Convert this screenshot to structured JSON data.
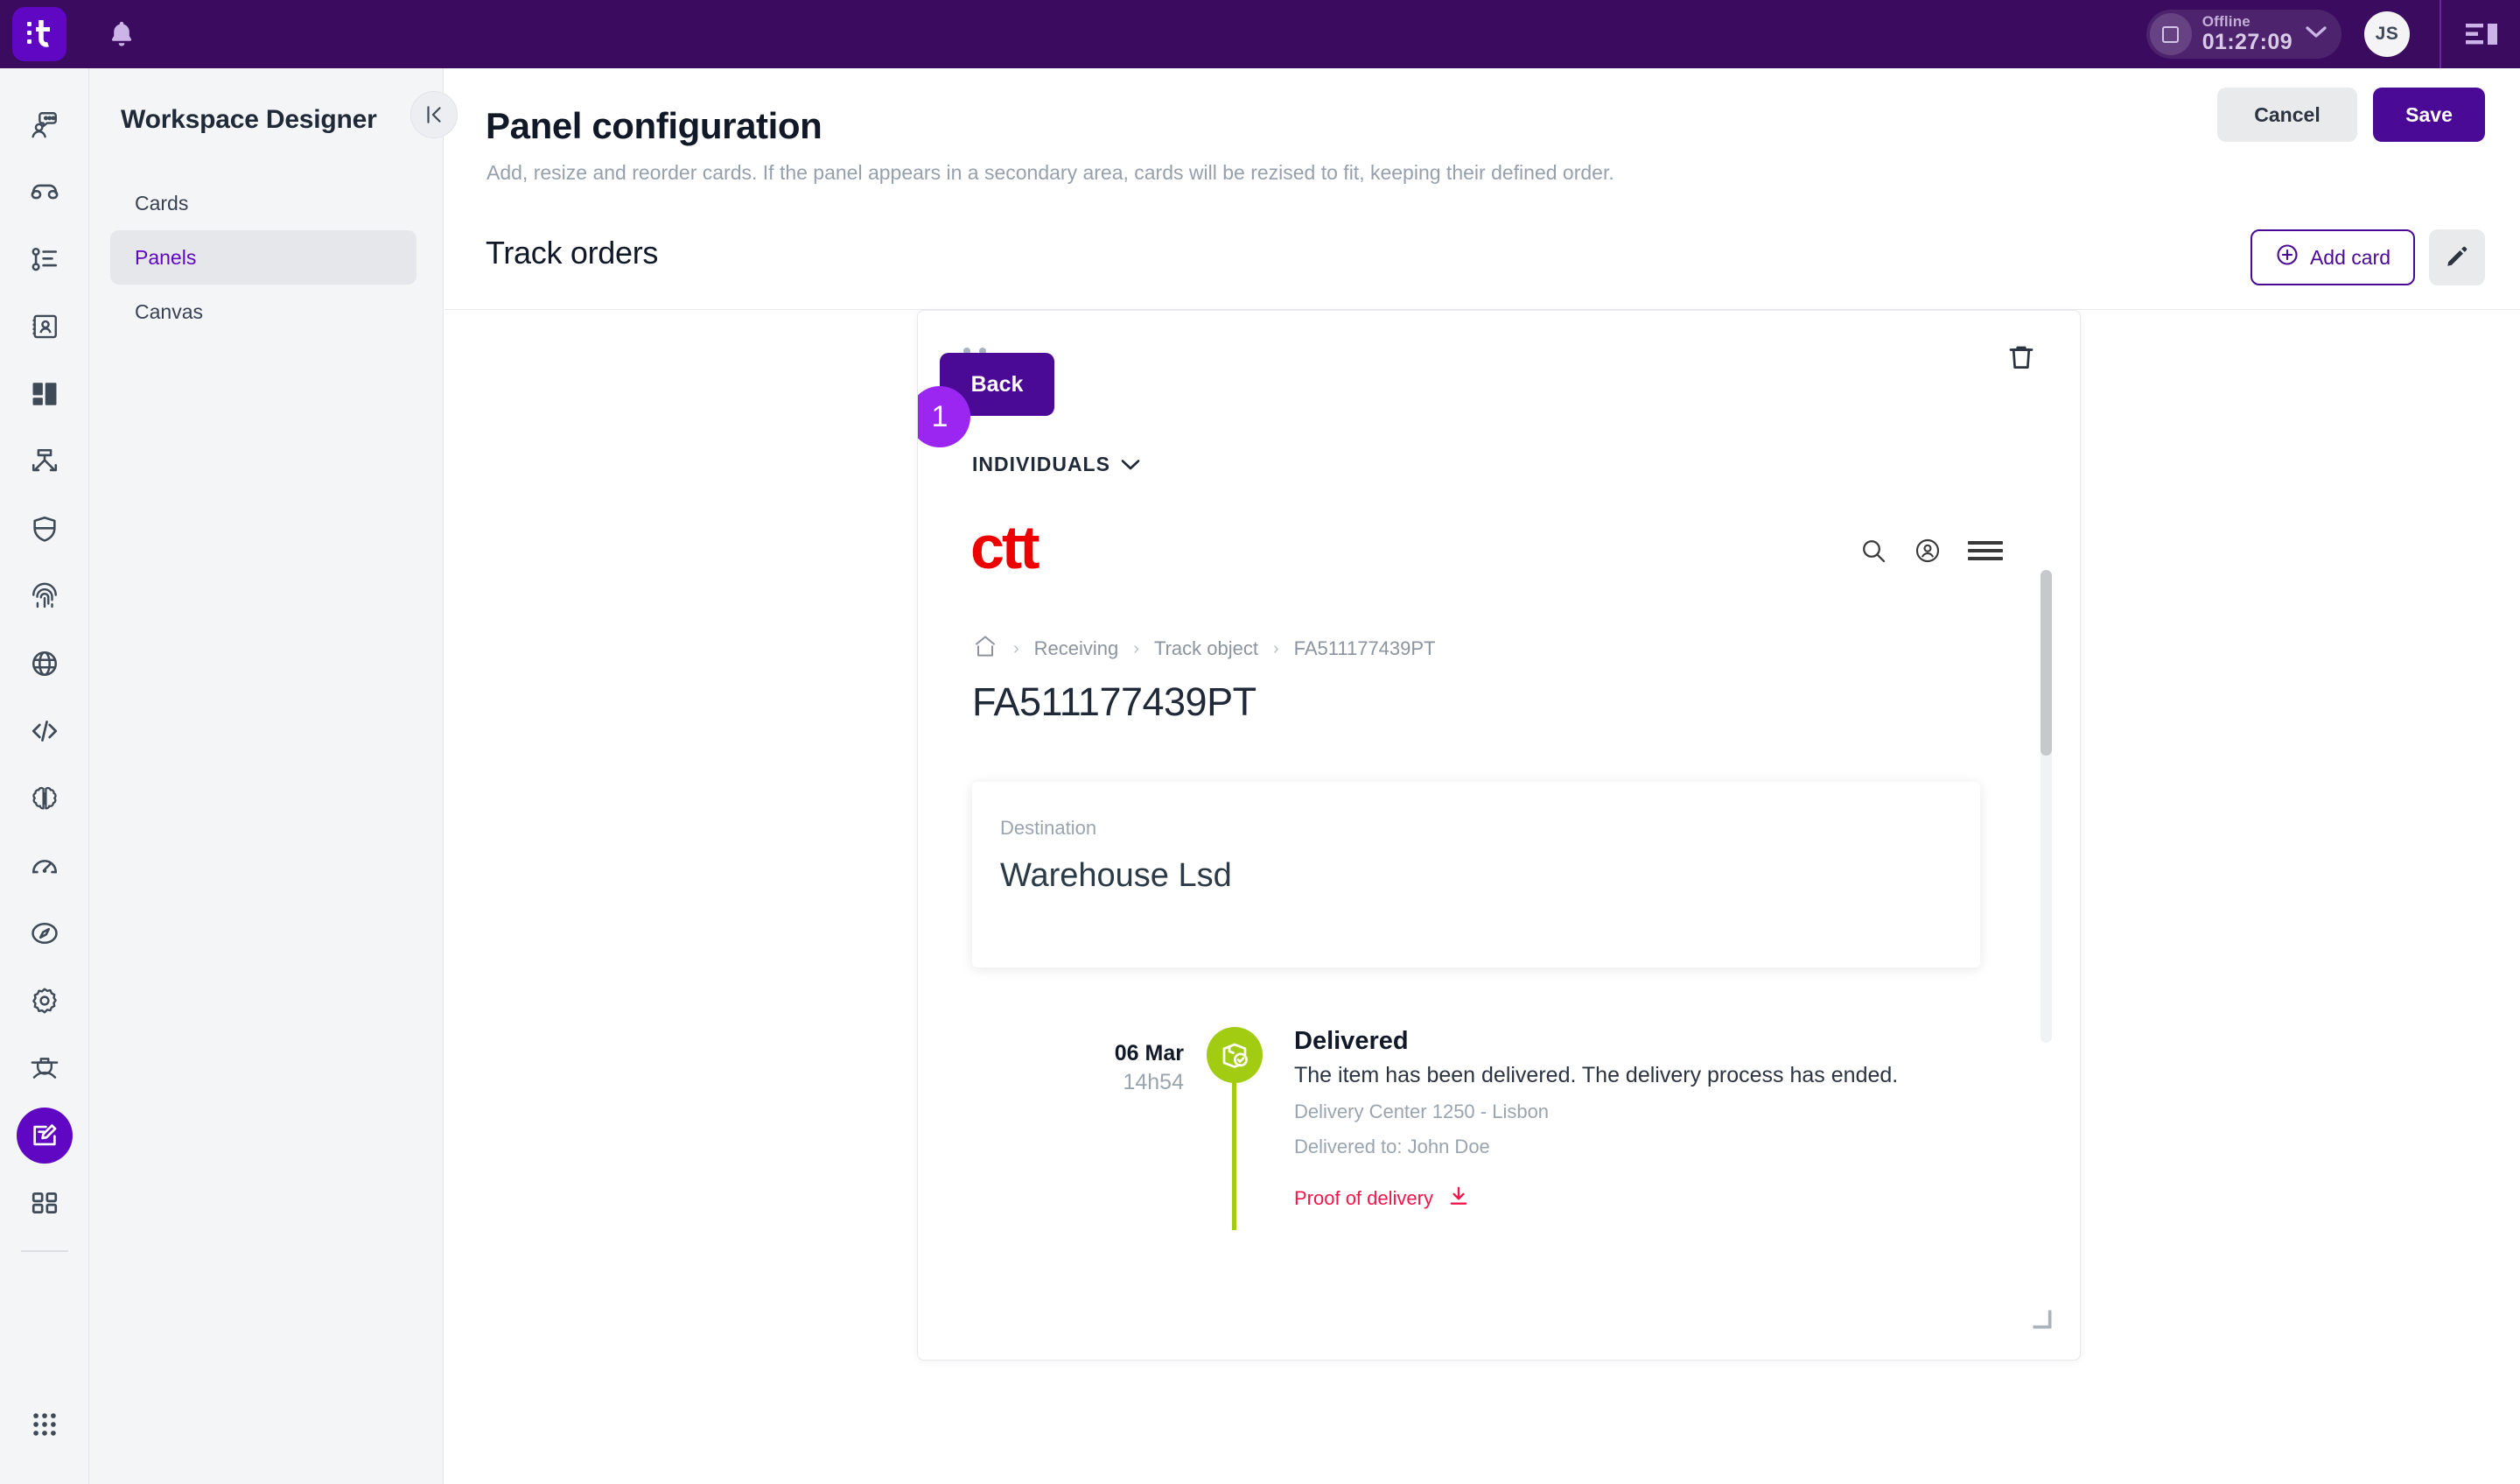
{
  "topbar": {
    "logo_icon": "app-logo-t",
    "bell_icon": "bell-icon",
    "status": {
      "icon": "stop-square-icon",
      "label": "Offline",
      "time": "01:27:09",
      "chevron_icon": "chevron-down-icon"
    },
    "avatar_initials": "JS",
    "panel_toggle_icon": "right-panel-icon"
  },
  "rail": {
    "items": [
      {
        "icon": "chat-agent-icon",
        "active": false
      },
      {
        "icon": "headset-icon",
        "active": false
      },
      {
        "icon": "queue-list-icon",
        "active": false
      },
      {
        "icon": "contact-book-icon",
        "active": false
      },
      {
        "icon": "layout-blocks-icon",
        "active": false
      },
      {
        "icon": "routing-flow-icon",
        "active": false
      },
      {
        "icon": "shield-icon",
        "active": false
      },
      {
        "icon": "fingerprint-icon",
        "active": false
      },
      {
        "icon": "globe-icon",
        "active": false
      },
      {
        "icon": "code-icon",
        "active": false
      },
      {
        "icon": "brain-icon",
        "active": false
      },
      {
        "icon": "gauge-icon",
        "active": false
      },
      {
        "icon": "compass-icon",
        "active": false
      },
      {
        "icon": "gear-icon",
        "active": false
      },
      {
        "icon": "graduation-icon",
        "active": false
      },
      {
        "icon": "designer-pencil-icon",
        "active": true
      },
      {
        "icon": "grid-squares-icon",
        "active": false
      }
    ],
    "bottom_item": {
      "icon": "apps-grid-icon"
    }
  },
  "sidebar": {
    "title": "Workspace Designer",
    "collapse_icon": "collapse-left-icon",
    "items": [
      {
        "label": "Cards",
        "active": false
      },
      {
        "label": "Panels",
        "active": true
      },
      {
        "label": "Canvas",
        "active": false
      }
    ]
  },
  "header": {
    "title": "Panel configuration",
    "subtitle": "Add, resize and reorder cards. If the panel appears in a secondary area, cards will be rezised to fit, keeping their defined order.",
    "cancel_label": "Cancel",
    "save_label": "Save"
  },
  "section": {
    "title": "Track orders",
    "add_card_label": "Add card",
    "add_card_icon": "plus-circle-icon",
    "edit_icon": "pencil-icon"
  },
  "card": {
    "drag_handle_icon": "drag-dots-icon",
    "delete_icon": "trash-icon",
    "resize_icon": "resize-corner-icon",
    "badge": "1",
    "back_label": "Back",
    "segment_label": "INDIVIDUALS",
    "segment_chevron_icon": "chevron-down-icon",
    "brand_logo": "ctt",
    "brand_icons": [
      "search-icon",
      "account-circle-icon",
      "hamburger-menu-icon"
    ],
    "breadcrumb": {
      "home_icon": "home-icon",
      "separator": "›",
      "items": [
        "Receiving",
        "Track object",
        "FA511177439PT"
      ]
    },
    "tracking_number": "FA511177439PT",
    "destination": {
      "label": "Destination",
      "value": "Warehouse Lsd"
    },
    "timeline": [
      {
        "date": "06 Mar",
        "time": "14h54",
        "status_icon": "package-check-icon",
        "status_color": "#a2cc12",
        "title": "Delivered",
        "description": "The item has been delivered. The delivery process has ended.",
        "meta": [
          "Delivery Center 1250 - Lisbon",
          "Delivered to: John Doe"
        ],
        "proof_label": "Proof of delivery",
        "proof_icon": "download-icon"
      }
    ]
  },
  "colors": {
    "topbar_bg": "#3a0b5e",
    "brand_purple": "#6007c3",
    "save_purple": "#4b0a95",
    "badge_purple": "#9b26f2",
    "ctt_red": "#ec0000",
    "proof_red": "#f4164a",
    "timeline_green": "#a2cc12"
  }
}
